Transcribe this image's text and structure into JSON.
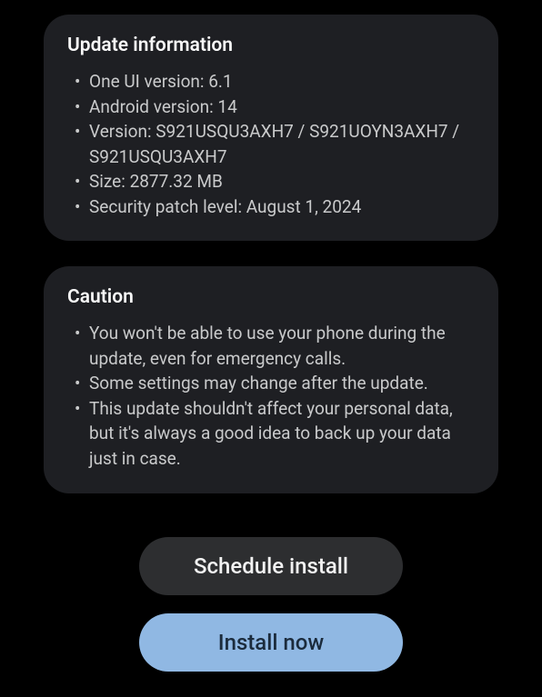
{
  "update_info": {
    "title": "Update information",
    "items": [
      "One UI version: 6.1",
      "Android version: 14",
      "Version: S921USQU3AXH7 / S921UOYN3AXH7 / S921USQU3AXH7",
      "Size: 2877.32 MB",
      "Security patch level: August 1, 2024"
    ]
  },
  "caution": {
    "title": "Caution",
    "items": [
      "You won't be able to use your phone during the update, even for emergency calls.",
      "Some settings may change after the update.",
      "This update shouldn't affect your personal data, but it's always a good idea to back up your data just in case."
    ]
  },
  "buttons": {
    "schedule": "Schedule install",
    "install": "Install now"
  }
}
